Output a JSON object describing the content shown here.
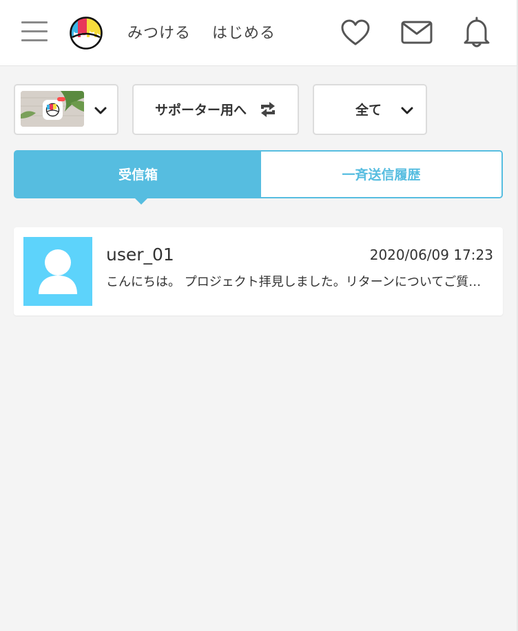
{
  "header": {
    "nav_links": [
      {
        "label": "みつける"
      },
      {
        "label": "はじめる"
      }
    ],
    "icons": [
      "menu-icon",
      "logo-icon",
      "heart-icon",
      "mail-icon",
      "bell-icon"
    ]
  },
  "toolbar": {
    "project_selector": {
      "icon": "chevron-down-icon"
    },
    "supporter_button": {
      "label": "サポーター用へ",
      "icon": "switch-icon"
    },
    "filter": {
      "selected": "全て",
      "icon": "chevron-down-icon"
    }
  },
  "tabs": [
    {
      "label": "受信箱",
      "active": true
    },
    {
      "label": "一斉送信履歴",
      "active": false
    }
  ],
  "messages": [
    {
      "user": "user_01",
      "timestamp": "2020/06/09 17:23",
      "preview": "こんにちは。 プロジェクト拝見しました。リターンについてご質問があります。",
      "avatar_icon": "user-avatar-icon"
    }
  ],
  "colors": {
    "accent": "#56bde0",
    "avatar_bg": "#5dd3fb",
    "background": "#f4f4f4",
    "logo_red": "#e8385a",
    "logo_yellow": "#f7dd3c",
    "logo_blue": "#3ab4e6"
  }
}
